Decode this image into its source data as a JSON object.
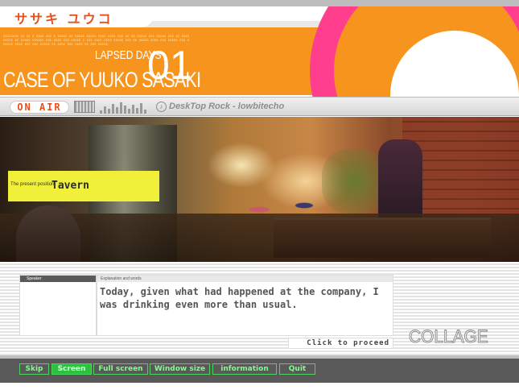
{
  "header": {
    "kana_title": "ササキ ユウコ",
    "fine_print": "cccccccc cc cc c cccc ccc c ccccc cc ccccc ccccc cccc cccc ccc cc cc ccccc ccc ccccc ccc cc cccc ccccc cc ccccc cccccc ccc cccc ccc ccccc c ccc cccc cccc ccccc ccc cc ccccc cccc ccc ccccc ccc c ccccc cccc ccc ccc ccccc cc cccc ccc cccc cc ccc ccccc",
    "elapsed_label": "LAPSED DAYS",
    "days_number": "01",
    "case_title": "CASE OF YUUKO SASAKI"
  },
  "status_bar": {
    "on_air": "ON AIR",
    "track": "DeskTop Rock - lowbitecho"
  },
  "position": {
    "label": "The present position",
    "value": "Tavern"
  },
  "dialogue": {
    "speaker_label": "Speaker",
    "speaker_name": "",
    "text_label": "Explanation and words",
    "text": "Today, given what had happened at the company, I was drinking even more than usual.",
    "proceed": "Click to proceed"
  },
  "brand": "COLLAGE",
  "toolbar": {
    "buttons": [
      {
        "label": "Skip"
      },
      {
        "label": "Screen"
      },
      {
        "label": "Full screen"
      },
      {
        "label": "Window size"
      },
      {
        "label": "information"
      },
      {
        "label": "Quit"
      }
    ],
    "active_index": 1
  },
  "colors": {
    "orange": "#f7941d",
    "pink": "#ff3f8e",
    "accent_red": "#e8501b",
    "toolbar_green": "#4cd35a",
    "position_yellow": "#f0f03a"
  },
  "icons": [
    "keyboard-icon",
    "equalizer-icon",
    "music-note-icon"
  ]
}
